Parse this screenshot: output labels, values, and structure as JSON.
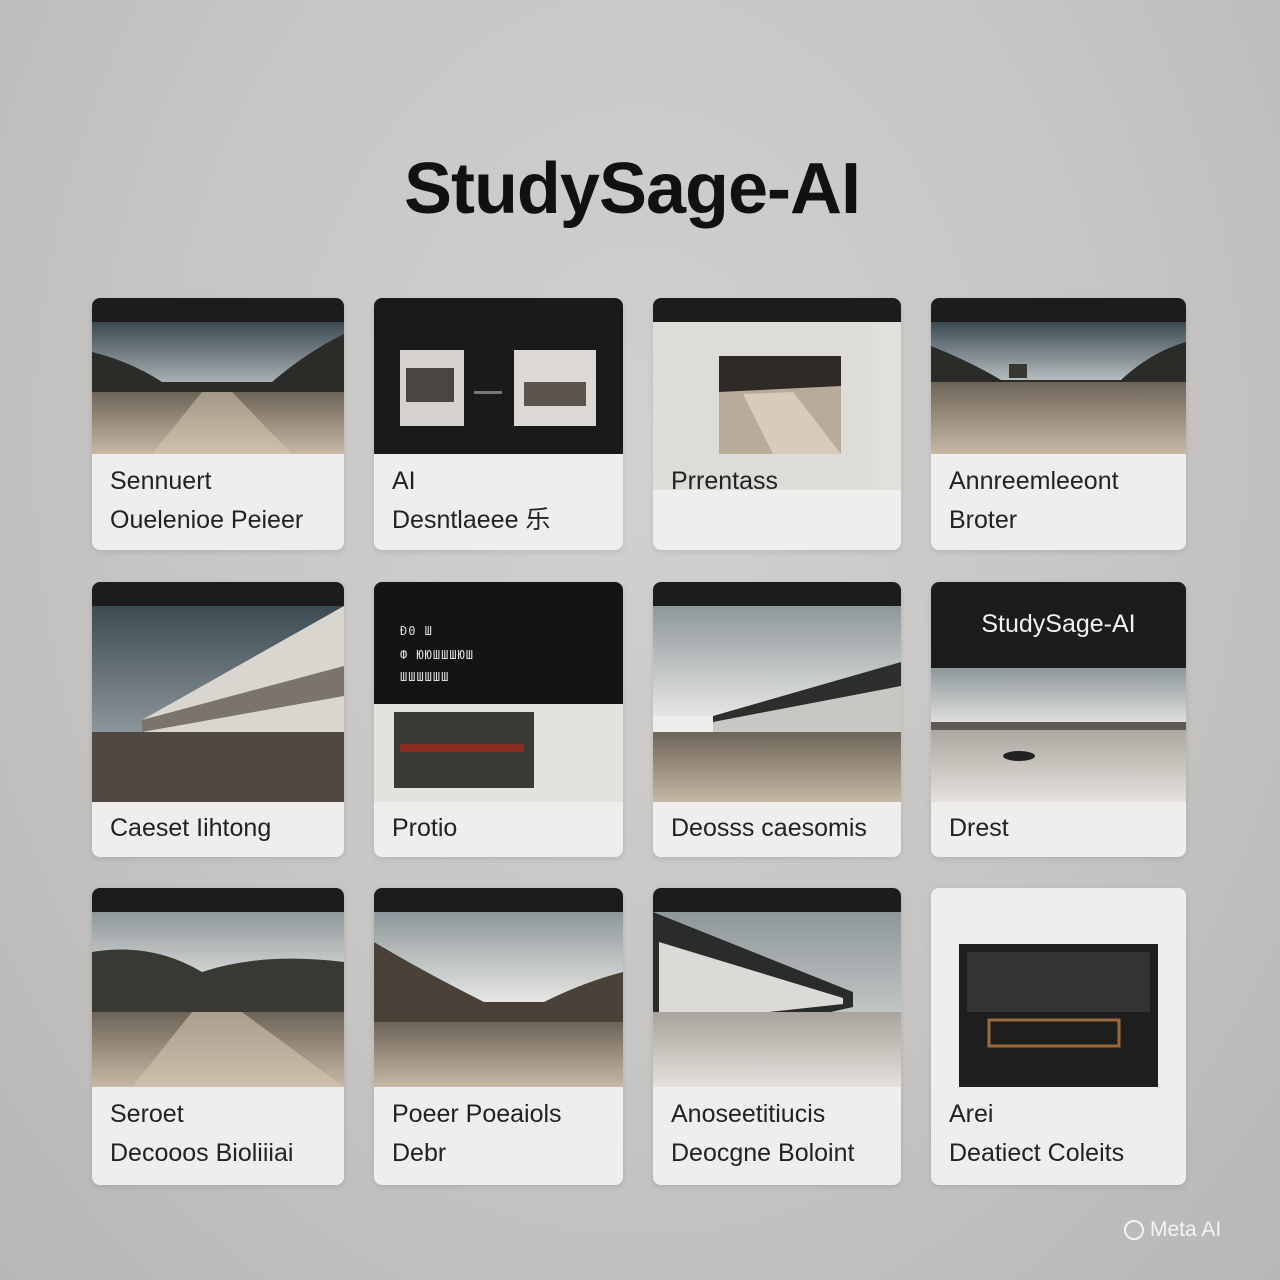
{
  "page": {
    "title": "StudySage-AI"
  },
  "cards": [
    {
      "line1": "Sennuert",
      "line2": "Ouelenioe Peieer"
    },
    {
      "line1": "AI",
      "line2": "Desntlaeee 乐"
    },
    {
      "line1": "",
      "line2": "Prrentass"
    },
    {
      "line1": "Annreemleeont",
      "line2": "Broter"
    },
    {
      "line1": "Caeset Iihtong",
      "line2": ""
    },
    {
      "line1": "Protio",
      "line2": "",
      "mini_lines": [
        "Ð0 Ш",
        "Ф ЮЮШШШЮШ",
        "ШШШШШШ"
      ]
    },
    {
      "line1": "Deosss caesomis",
      "line2": ""
    },
    {
      "line1": "Drest",
      "line2": "",
      "overlay_title": "StudySage-AI"
    },
    {
      "line1": "Seroet",
      "line2": "Decooos Bioliiiai"
    },
    {
      "line1": "Poeer Poeaiols",
      "line2": "Debr"
    },
    {
      "line1": "Anoseetitiucis",
      "line2": "Deocgne Boloint"
    },
    {
      "line1": "Arei",
      "line2": "Deatiect Coleits"
    }
  ],
  "watermark": {
    "label": "Meta AI"
  },
  "colors": {
    "background": "#c7c5c3",
    "card": "#efeeec",
    "bar": "#1c1c1c"
  },
  "icons": {
    "watermark": "meta-ai-ring-icon"
  }
}
